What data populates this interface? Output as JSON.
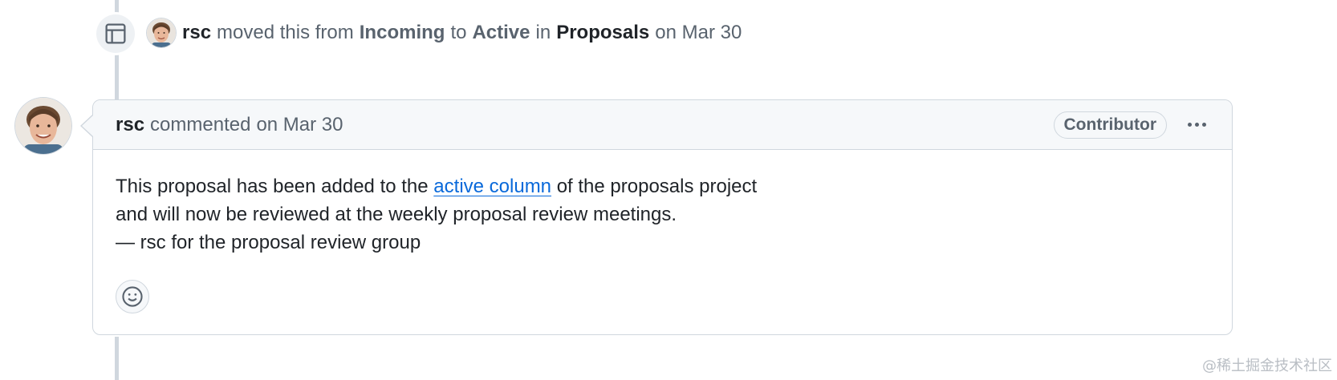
{
  "event": {
    "icon": "project-table-icon",
    "author": "rsc",
    "text_moved": "moved this from",
    "from_column": "Incoming",
    "text_to": "to",
    "to_column": "Active",
    "text_in": "in",
    "project": "Proposals",
    "date": "on Mar 30"
  },
  "comment": {
    "author": "rsc",
    "action": "commented",
    "date": "on Mar 30",
    "role_badge": "Contributor",
    "body_prefix": "This proposal has been added to the",
    "body_link": "active column",
    "body_suffix": "of the proposals project",
    "body_line2": "and will now be reviewed at the weekly proposal review meetings.",
    "body_line3": "— rsc for the proposal review group"
  },
  "watermark": "@稀土掘金技术社区",
  "colors": {
    "link": "#0969da",
    "border": "#d0d7de",
    "header_bg": "#f6f8fa",
    "muted_text": "#59636e"
  }
}
